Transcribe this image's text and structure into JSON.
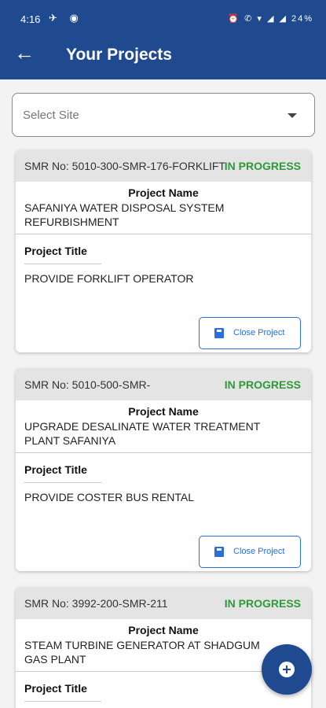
{
  "status_bar": {
    "time": "4:16",
    "left_icons": "✈ ◉",
    "right_icons": "⏰ ✆ ▾ ◢ ◢ 24%",
    "battery": "24%"
  },
  "appbar": {
    "title": "Your Projects",
    "back_icon": "arrow-left-icon"
  },
  "site_select": {
    "placeholder": "Select Site"
  },
  "project_name_label": "Project Name",
  "project_title_label": "Project Title",
  "close_label": "Close Project",
  "projects": [
    {
      "smr": "SMR No: 5010-300-SMR-176-FORKLIFT",
      "status": "IN PROGRESS",
      "name": "SAFANIYA WATER DISPOSAL SYSTEM REFURBISHMENT",
      "title": "PROVIDE FORKLIFT OPERATOR"
    },
    {
      "smr": "SMR No: 5010-500-SMR-",
      "status": "IN PROGRESS",
      "name": "UPGRADE DESALINATE WATER TREATMENT PLANT SAFANIYA",
      "title": "PROVIDE COSTER BUS RENTAL"
    },
    {
      "smr": "SMR No: 3992-200-SMR-211",
      "status": "IN PROGRESS",
      "name": "STEAM TURBINE GENERATOR AT SHADGUM GAS PLANT",
      "title": ""
    }
  ],
  "colors": {
    "primary": "#1f4a8f",
    "status_green": "#2e9a38",
    "button_blue": "#2b6fd9"
  }
}
